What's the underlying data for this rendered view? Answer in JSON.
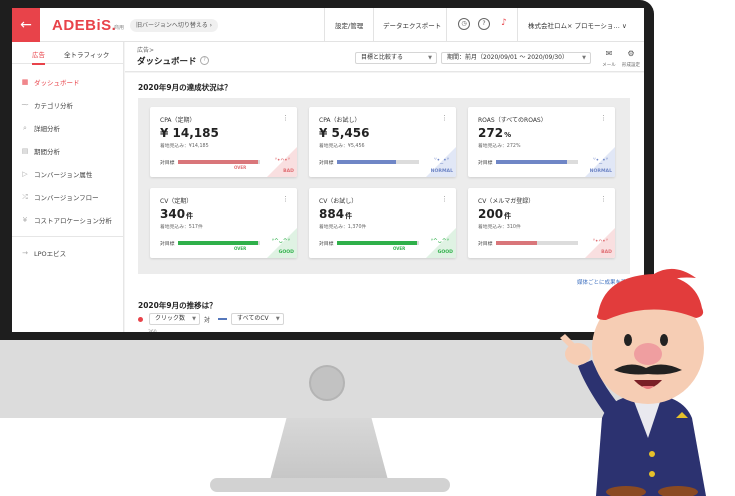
{
  "app": {
    "logo": "ADEBiS.",
    "logo_sub": "商用",
    "switch_version": "旧バージョンへ切り替える ›"
  },
  "topbar": {
    "settings": "設定/管理",
    "data_export": "データエクスポート",
    "account": "株式会社ロム× プロモーショ… ∨",
    "icons": [
      "clock-icon",
      "help-icon",
      "bell-icon"
    ]
  },
  "sidebar": {
    "tabs": [
      {
        "label": "広告",
        "active": true
      },
      {
        "label": "全トラフィック",
        "active": false
      }
    ],
    "items": [
      {
        "icon": "grid-icon",
        "label": "ダッシュボード",
        "active": true
      },
      {
        "icon": "chart-icon",
        "label": "カテゴリ分析",
        "active": false
      },
      {
        "icon": "magnifier-icon",
        "label": "詳細分析",
        "active": false
      },
      {
        "icon": "calendar-icon",
        "label": "期間分析",
        "active": false
      },
      {
        "icon": "flag-icon",
        "label": "コンバージョン属性",
        "active": false
      },
      {
        "icon": "flow-icon",
        "label": "コンバージョンフロー",
        "active": false
      },
      {
        "icon": "yen-icon",
        "label": "コストアロケーション分析",
        "active": false
      },
      {
        "icon": "arrow-icon",
        "label": "LPOエビス",
        "active": false
      }
    ]
  },
  "page_header": {
    "breadcrumb": "広告>",
    "title": "ダッシュボード",
    "compare_select": "目標と比較する",
    "period_select": "期間：前月（2020/09/01 ～ 2020/09/30）",
    "mail_label": "メール",
    "report_label": "形成設定"
  },
  "status_section": {
    "title": "2020年9月の達成状況は？",
    "target_label": "対目標",
    "cards": [
      {
        "label": "CPA（定期）",
        "value": "¥ 14,185",
        "unit": "",
        "forecast": "着地見込み：¥14,185",
        "progress": 0.98,
        "bar_color": "#d9767a",
        "bar_status": "OVER",
        "status": "BAD",
        "status_color": "#e06f74",
        "corner_color": "#f9dfe0",
        "face": "ᐡ•ᴖ•ᐡ"
      },
      {
        "label": "CPA（お試し）",
        "value": "¥ 5,456",
        "unit": "",
        "forecast": "着地見込み：¥5,456",
        "progress": 0.72,
        "bar_color": "#6f86c6",
        "bar_status": "",
        "status": "NORMAL",
        "status_color": "#6f86c6",
        "corner_color": "#e1e7f6",
        "face": "ᐡ•_•ᐡ"
      },
      {
        "label": "ROAS（すべてのROAS）",
        "value": "272",
        "unit": "%",
        "forecast": "着地見込み：272%",
        "progress": 0.86,
        "bar_color": "#6f86c6",
        "bar_status": "",
        "status": "NORMAL",
        "status_color": "#6f86c6",
        "corner_color": "#e1e7f6",
        "face": "ᐡ•_•ᐡ"
      },
      {
        "label": "CV（定期）",
        "value": "340",
        "unit": "件",
        "forecast": "着地見込み：517件",
        "progress": 0.98,
        "bar_color": "#2fb04a",
        "bar_status": "OVER",
        "status": "GOOD",
        "status_color": "#2fb04a",
        "corner_color": "#dff2e3",
        "face": "ᐡ^ᴗ^ᐡ"
      },
      {
        "label": "CV（お試し）",
        "value": "884",
        "unit": "件",
        "forecast": "着地見込み：1,370件",
        "progress": 0.98,
        "bar_color": "#2fb04a",
        "bar_status": "OVER",
        "status": "GOOD",
        "status_color": "#2fb04a",
        "corner_color": "#dff2e3",
        "face": "ᐡ^ᴗ^ᐡ"
      },
      {
        "label": "CV（メルマガ登録）",
        "value": "200",
        "unit": "件",
        "forecast": "着地見込み：310件",
        "progress": 0.5,
        "bar_color": "#d9767a",
        "bar_status": "",
        "status": "BAD",
        "status_color": "#e06f74",
        "corner_color": "#f9dfe0",
        "face": "ᐡ•ᴖ•ᐡ"
      }
    ],
    "media_link": "媒体ごとに成果を確認"
  },
  "trend_section": {
    "title": "2020年9月の推移は？",
    "metric_select": "クリック数",
    "vs_label": "対",
    "cv_select": "すべてのCV",
    "axis_tick": "360"
  }
}
